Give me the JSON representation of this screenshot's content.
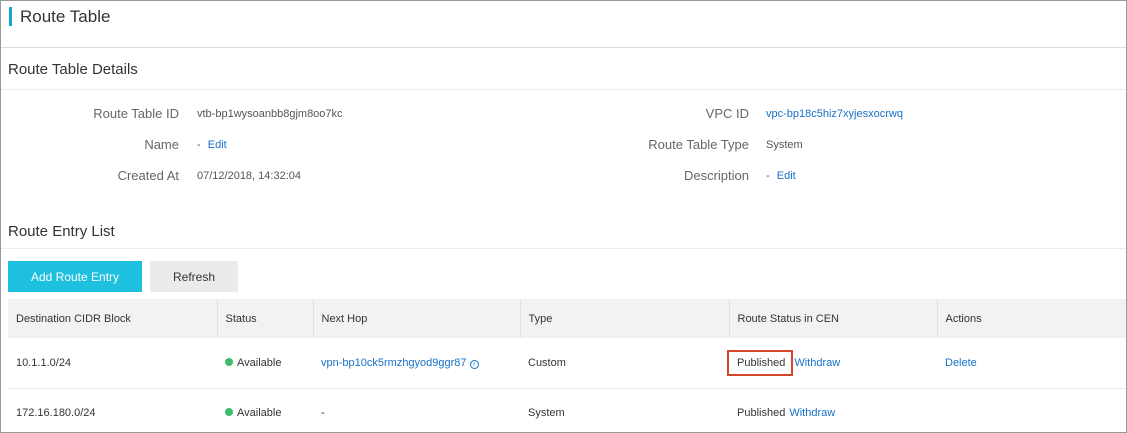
{
  "page": {
    "title": "Route Table"
  },
  "details": {
    "section_title": "Route Table Details",
    "route_table_id": {
      "label": "Route Table ID",
      "value": "vtb-bp1wysoanbb8gjm8oo7kc"
    },
    "name": {
      "label": "Name",
      "value": "-",
      "edit": "Edit"
    },
    "created_at": {
      "label": "Created At",
      "value": "07/12/2018, 14:32:04"
    },
    "vpc_id": {
      "label": "VPC ID",
      "value": "vpc-bp18c5hiz7xyjesxocrwq"
    },
    "route_table_type": {
      "label": "Route Table Type",
      "value": "System"
    },
    "description": {
      "label": "Description",
      "value": "-",
      "edit": "Edit"
    }
  },
  "entries": {
    "section_title": "Route Entry List",
    "add_button": "Add Route Entry",
    "refresh_button": "Refresh",
    "columns": [
      "Destination CIDR Block",
      "Status",
      "Next Hop",
      "Type",
      "Route Status in CEN",
      "Actions"
    ],
    "rows": [
      {
        "cidr": "10.1.1.0/24",
        "status": "Available",
        "next_hop": "vpn-bp10ck5rmzhgyod9ggr87",
        "type": "Custom",
        "cen_status": "Published",
        "cen_action": "Withdraw",
        "action": "Delete"
      },
      {
        "cidr": "172.16.180.0/24",
        "status": "Available",
        "next_hop": "-",
        "type": "System",
        "cen_status": "Published",
        "cen_action": "Withdraw",
        "action": ""
      }
    ]
  },
  "colors": {
    "accent": "#1ec0e0",
    "link": "#1672c9",
    "available": "#3cbb6a",
    "highlight": "#d9462b"
  }
}
